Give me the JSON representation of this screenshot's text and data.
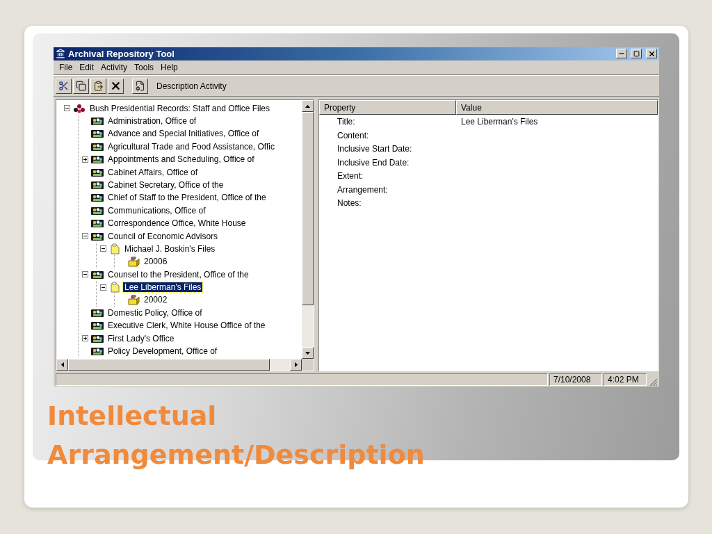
{
  "slide_title": "Intellectual Arrangement/Description",
  "window": {
    "title": "Archival Repository Tool"
  },
  "menu": [
    "File",
    "Edit",
    "Activity",
    "Tools",
    "Help"
  ],
  "toolbar": {
    "buttons": [
      {
        "kind": "cut"
      },
      {
        "kind": "copy"
      },
      {
        "kind": "paste"
      },
      {
        "kind": "delete"
      },
      {
        "kind": "properties"
      }
    ],
    "label": "Description Activity"
  },
  "tree": [
    {
      "label": "Bush Presidential Records: Staff and Office Files",
      "kind": "collection",
      "expanded": true,
      "selected": false,
      "children": [
        {
          "label": "Administration, Office of",
          "kind": "office",
          "selected": false
        },
        {
          "label": "Advance and Special Initiatives, Office of",
          "kind": "office",
          "selected": false
        },
        {
          "label": "Agricultural Trade and Food Assistance, Offic",
          "kind": "office",
          "selected": false
        },
        {
          "label": "Appointments and Scheduling, Office of",
          "kind": "office",
          "expanded": false,
          "selected": false
        },
        {
          "label": "Cabinet Affairs, Office of",
          "kind": "office",
          "selected": false
        },
        {
          "label": "Cabinet Secretary, Office of the",
          "kind": "office",
          "selected": false
        },
        {
          "label": "Chief of Staff to the President, Office of the",
          "kind": "office",
          "selected": false
        },
        {
          "label": "Communications, Office of",
          "kind": "office",
          "selected": false
        },
        {
          "label": "Correspondence Office, White House",
          "kind": "office",
          "selected": false
        },
        {
          "label": "Council of Economic Advisors",
          "kind": "office",
          "expanded": true,
          "selected": false,
          "children": [
            {
              "label": "Michael J. Boskin's Files",
              "kind": "files",
              "expanded": true,
              "selected": false,
              "children": [
                {
                  "label": "20006",
                  "kind": "box",
                  "selected": false
                }
              ]
            }
          ]
        },
        {
          "label": "Counsel to the President, Office of the",
          "kind": "office",
          "expanded": true,
          "selected": false,
          "children": [
            {
              "label": "Lee Liberman's Files",
              "kind": "files",
              "expanded": true,
              "selected": true,
              "children": [
                {
                  "label": "20002",
                  "kind": "box",
                  "selected": false
                }
              ]
            }
          ]
        },
        {
          "label": "Domestic Policy, Office of",
          "kind": "office",
          "selected": false
        },
        {
          "label": "Executive Clerk, White House Office of the",
          "kind": "office",
          "selected": false
        },
        {
          "label": "First Lady's Office",
          "kind": "office",
          "expanded": false,
          "selected": false
        },
        {
          "label": "Policy Development, Office of",
          "kind": "office",
          "selected": false
        }
      ]
    }
  ],
  "properties": {
    "columns": [
      "Property",
      "Value"
    ],
    "rows": [
      {
        "property": "Title:",
        "value": "Lee Liberman's Files"
      },
      {
        "property": "Content:"
      },
      {
        "property": "Inclusive Start Date:"
      },
      {
        "property": "Inclusive End Date:"
      },
      {
        "property": "Extent:"
      },
      {
        "property": "Arrangement:"
      },
      {
        "property": "Notes:"
      }
    ]
  },
  "status_bar": [
    "7/10/2008",
    "4:02 PM"
  ]
}
